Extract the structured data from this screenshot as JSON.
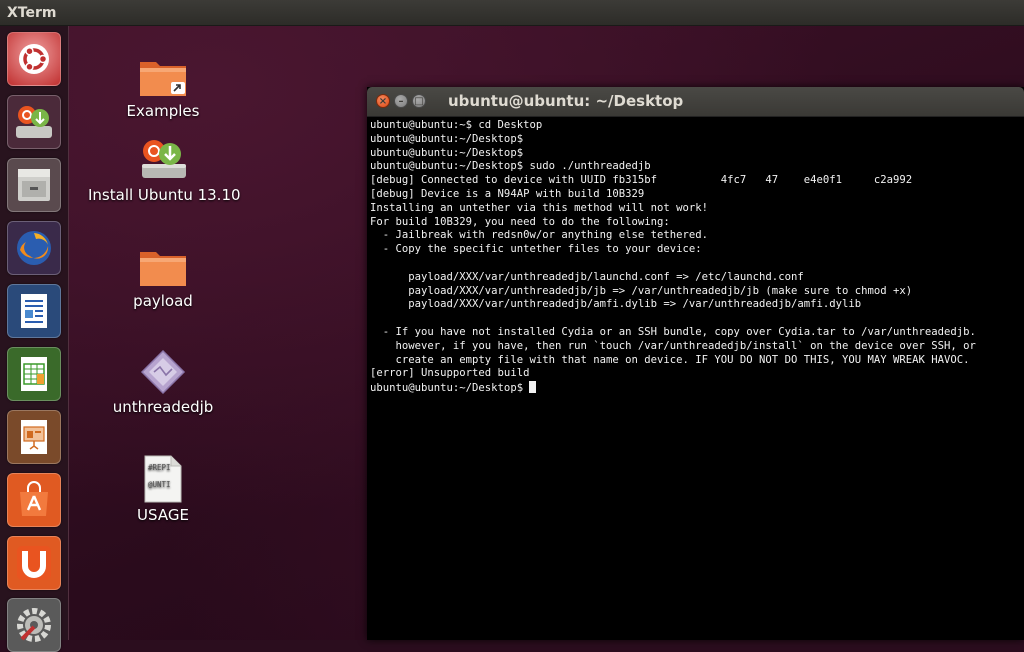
{
  "top_panel": {
    "app_name": "XTerm"
  },
  "launcher": {
    "items": [
      {
        "name": "ubuntu-dash",
        "icon": "ubuntu-logo-icon"
      },
      {
        "name": "install-ubuntu",
        "icon": "installer-icon"
      },
      {
        "name": "files",
        "icon": "file-cabinet-icon"
      },
      {
        "name": "firefox",
        "icon": "firefox-icon"
      },
      {
        "name": "libreoffice-writer",
        "icon": "writer-document-icon"
      },
      {
        "name": "libreoffice-calc",
        "icon": "calc-spreadsheet-icon"
      },
      {
        "name": "libreoffice-impress",
        "icon": "impress-presentation-icon"
      },
      {
        "name": "ubuntu-software-center",
        "icon": "shopping-bag-icon"
      },
      {
        "name": "ubuntu-one",
        "icon": "ubuntu-one-icon"
      },
      {
        "name": "system-settings",
        "icon": "settings-gear-icon"
      }
    ]
  },
  "desktop": {
    "icons": [
      {
        "label": "Examples",
        "icon": "folder-link-icon"
      },
      {
        "label": "Install Ubuntu 13.10",
        "icon": "installer-icon"
      },
      {
        "label": "payload",
        "icon": "folder-icon"
      },
      {
        "label": "unthreadedjb",
        "icon": "executable-icon"
      },
      {
        "label": "USAGE",
        "icon": "text-file-icon",
        "preview_lines": [
          "#REPI",
          "@UNTI"
        ]
      }
    ]
  },
  "terminal": {
    "title": "ubuntu@ubuntu: ~/Desktop",
    "lines": [
      "ubuntu@ubuntu:~$ cd Desktop",
      "ubuntu@ubuntu:~/Desktop$",
      "ubuntu@ubuntu:~/Desktop$",
      "ubuntu@ubuntu:~/Desktop$ sudo ./unthreadedjb",
      "[debug] Connected to device with UUID fb315bf          4fc7   47    e4e0f1     c2a992",
      "[debug] Device is a N94AP with build 10B329",
      "Installing an untether via this method will not work!",
      "For build 10B329, you need to do the following:",
      "  - Jailbreak with redsn0w/or anything else tethered.",
      "  - Copy the specific untether files to your device:",
      "",
      "      payload/XXX/var/unthreadedjb/launchd.conf => /etc/launchd.conf",
      "      payload/XXX/var/unthreadedjb/jb => /var/unthreadedjb/jb (make sure to chmod +x)",
      "      payload/XXX/var/unthreadedjb/amfi.dylib => /var/unthreadedjb/amfi.dylib",
      "",
      "  - If you have not installed Cydia or an SSH bundle, copy over Cydia.tar to /var/unthreadedjb.",
      "    however, if you have, then run `touch /var/unthreadedjb/install` on the device over SSH, or",
      "    create an empty file with that name on device. IF YOU DO NOT DO THIS, YOU MAY WREAK HAVOC.",
      "[error] Unsupported build"
    ],
    "prompt": "ubuntu@ubuntu:~/Desktop$ "
  }
}
